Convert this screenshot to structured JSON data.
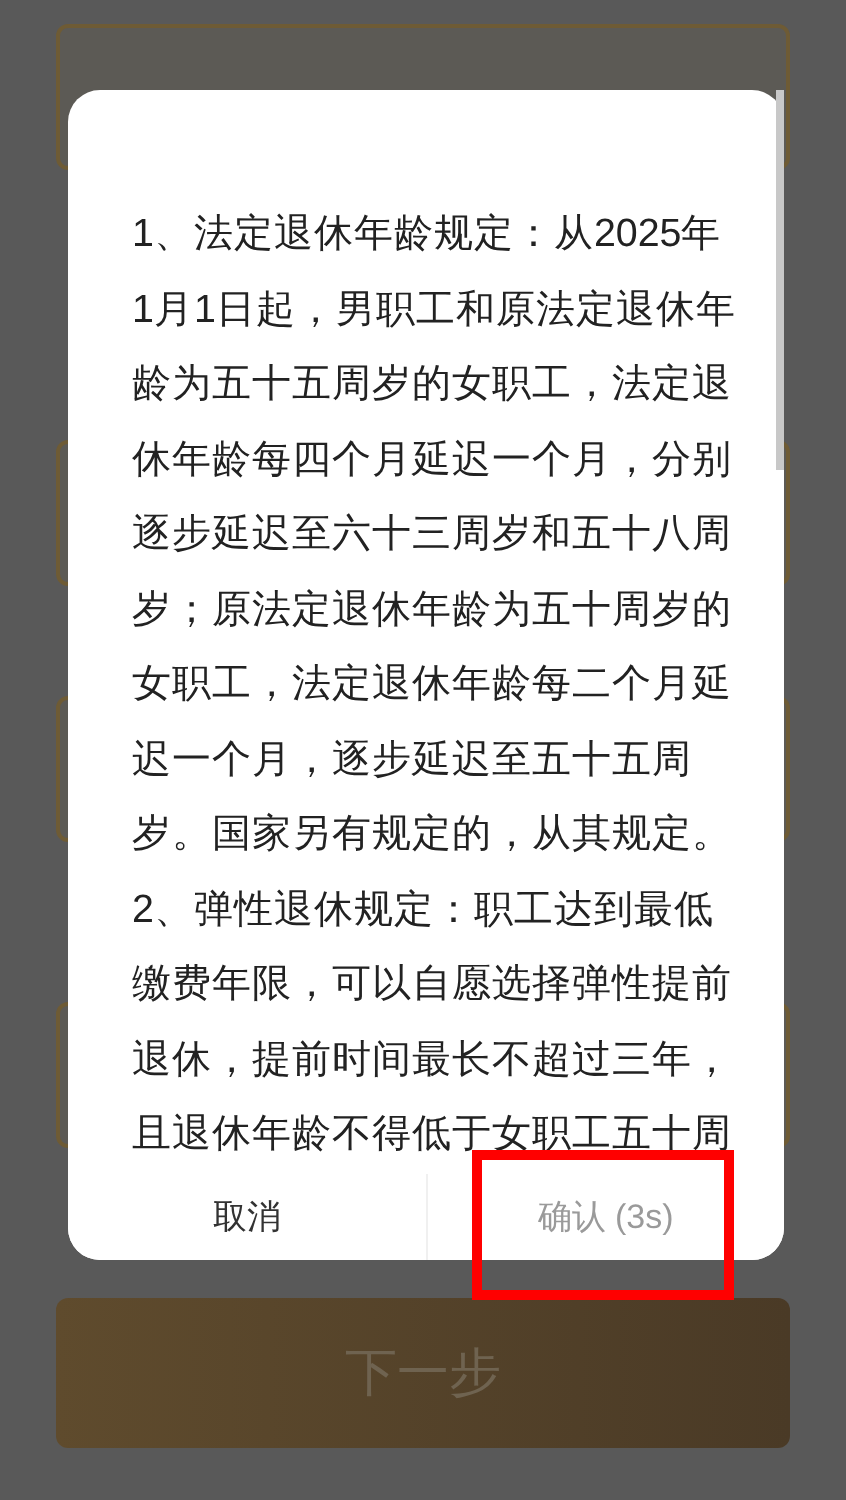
{
  "page": {
    "next_button": {
      "label": "下一步",
      "disabled": true
    }
  },
  "dialog": {
    "paragraphs": [
      "1、法定退休年龄规定：从2025年1月1日起，男职工和原法定退休年龄为五十五周岁的女职工，法定退休年龄每四个月延迟一个月，分别逐步延迟至六十三周岁和五十八周岁；原法定退休年龄为五十周岁的女职工，法定退休年龄每二个月延迟一个月，逐步延迟至五十五周岁。国家另有规定的，从其规定。",
      "2、弹性退休规定：职工达到最低缴费年限，可以自愿选择弹性提前退休，提前时间最长不超过三年，且退休年龄不得低于女职工五十周"
    ],
    "buttons": [
      {
        "label": "取消",
        "disabled": false
      },
      {
        "label": "确认 (3s)",
        "disabled": true
      }
    ]
  }
}
